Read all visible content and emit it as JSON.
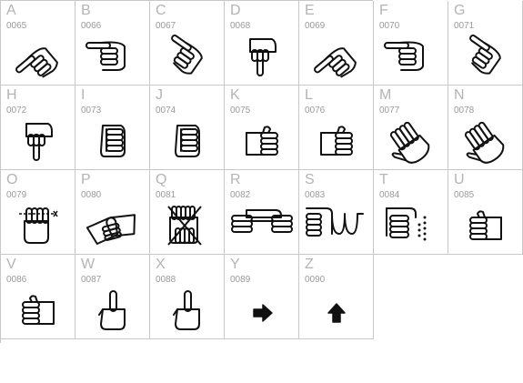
{
  "glyph_color": "#111111",
  "cells": [
    {
      "letter": "A",
      "code": "0065",
      "icon": "hand-pointing-up-left-icon"
    },
    {
      "letter": "B",
      "code": "0066",
      "icon": "hand-pointing-left-icon"
    },
    {
      "letter": "C",
      "code": "0067",
      "icon": "hand-pointing-down-left-icon"
    },
    {
      "letter": "D",
      "code": "0068",
      "icon": "hand-pointing-down-icon"
    },
    {
      "letter": "E",
      "code": "0069",
      "icon": "hand-pointing-up-left-icon"
    },
    {
      "letter": "F",
      "code": "0070",
      "icon": "hand-pointing-left-icon"
    },
    {
      "letter": "G",
      "code": "0071",
      "icon": "hand-pointing-down-left-icon"
    },
    {
      "letter": "H",
      "code": "0072",
      "icon": "hand-pointing-down-icon"
    },
    {
      "letter": "I",
      "code": "0073",
      "icon": "fist-icon"
    },
    {
      "letter": "J",
      "code": "0074",
      "icon": "fist-icon"
    },
    {
      "letter": "K",
      "code": "0075",
      "icon": "flat-hand-right-icon"
    },
    {
      "letter": "L",
      "code": "0076",
      "icon": "flat-hand-right-icon"
    },
    {
      "letter": "M",
      "code": "0077",
      "icon": "open-hand-tilted-icon"
    },
    {
      "letter": "N",
      "code": "0078",
      "icon": "open-hand-tilted-icon"
    },
    {
      "letter": "O",
      "code": "0079",
      "icon": "hand-cut-icon"
    },
    {
      "letter": "P",
      "code": "0080",
      "icon": "handshake-icon"
    },
    {
      "letter": "Q",
      "code": "0081",
      "icon": "crossed-hands-icon"
    },
    {
      "letter": "R",
      "code": "0082",
      "icon": "clasped-hands-icon"
    },
    {
      "letter": "S",
      "code": "0083",
      "icon": "linked-hands-icon"
    },
    {
      "letter": "T",
      "code": "0084",
      "icon": "hand-dotted-icon"
    },
    {
      "letter": "U",
      "code": "0085",
      "icon": "flat-hand-left-icon"
    },
    {
      "letter": "V",
      "code": "0086",
      "icon": "flat-hand-left-icon"
    },
    {
      "letter": "W",
      "code": "0087",
      "icon": "middle-finger-icon"
    },
    {
      "letter": "X",
      "code": "0088",
      "icon": "middle-finger-icon"
    },
    {
      "letter": "Y",
      "code": "0089",
      "icon": "arrow-right-icon"
    },
    {
      "letter": "Z",
      "code": "0090",
      "icon": "arrow-up-icon"
    }
  ]
}
